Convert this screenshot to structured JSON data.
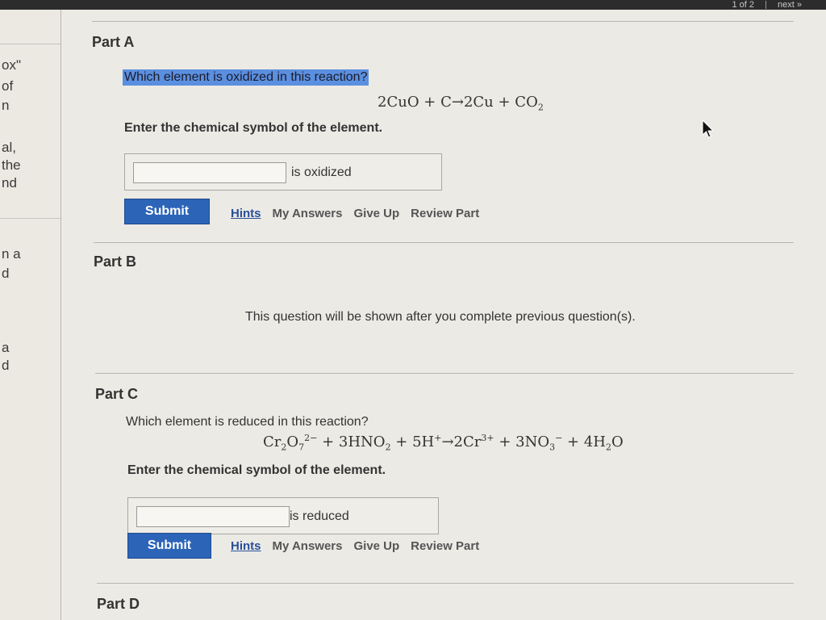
{
  "nav": {
    "counter": "1 of 2",
    "next_label": "next »"
  },
  "sidebar": {
    "fragments": [
      "ox\"",
      "of",
      "n",
      "al,",
      "the",
      "nd",
      "n a",
      "d",
      "a",
      "d"
    ]
  },
  "partA": {
    "label": "Part A",
    "question": "Which element is oxidized in this reaction?",
    "instruction": "Enter the chemical symbol of the element.",
    "input_value": "",
    "suffix": "is oxidized",
    "submit": "Submit",
    "links": [
      "Hints",
      "My Answers",
      "Give Up",
      "Review Part"
    ]
  },
  "partB": {
    "label": "Part B",
    "notice": "This question will be shown after you complete previous question(s)."
  },
  "partC": {
    "label": "Part C",
    "question": "Which element is reduced in this reaction?",
    "instruction": "Enter the chemical symbol of the element.",
    "input_value": "",
    "suffix": "is reduced",
    "submit": "Submit",
    "links": [
      "Hints",
      "My Answers",
      "Give Up",
      "Review Part"
    ]
  },
  "partD": {
    "label": "Part D"
  },
  "colors": {
    "accent": "#2c64b8",
    "highlight": "#5b8fe0",
    "link": "#2a4f9a"
  }
}
